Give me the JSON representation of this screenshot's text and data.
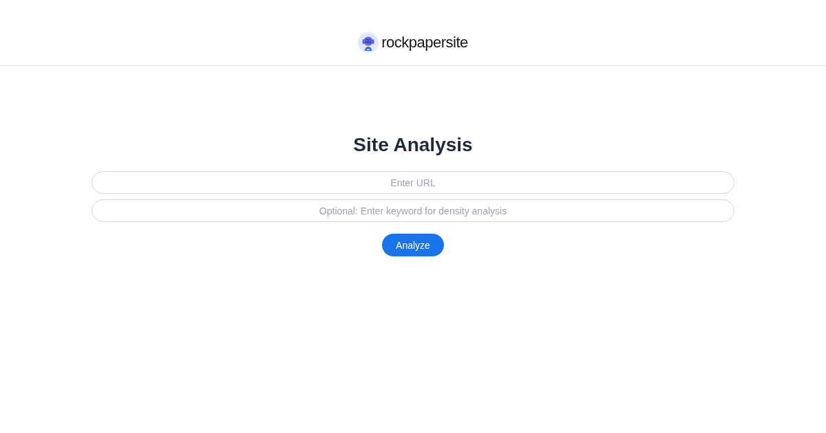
{
  "header": {
    "logo_text": "rockpapersite"
  },
  "title": "Site Analysis",
  "fields": [
    {
      "placeholder": "Enter URL"
    },
    {
      "placeholder": "Optional: Enter keyword for density analysis"
    }
  ],
  "button": {
    "label": "Analyze"
  }
}
